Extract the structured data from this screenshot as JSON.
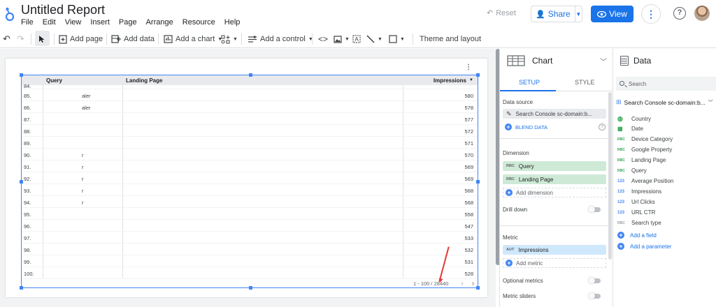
{
  "header": {
    "title": "Untitled Report",
    "menu": [
      "File",
      "Edit",
      "View",
      "Insert",
      "Page",
      "Arrange",
      "Resource",
      "Help"
    ],
    "reset_label": "Reset",
    "share_label": "Share",
    "view_label": "View"
  },
  "toolbar": {
    "add_page": "Add page",
    "add_data": "Add data",
    "add_chart": "Add a chart",
    "add_control": "Add a control",
    "theme_layout": "Theme and layout"
  },
  "table": {
    "headers": {
      "query": "Query",
      "landing_page": "Landing Page",
      "impressions": "Impressions"
    },
    "rows": [
      {
        "idx": "84.",
        "query": "",
        "lp": "",
        "imp": ""
      },
      {
        "idx": "85.",
        "query": "aler",
        "lp": "",
        "imp": "580"
      },
      {
        "idx": "86.",
        "query": "aler",
        "lp": "",
        "imp": "578"
      },
      {
        "idx": "87.",
        "query": "",
        "lp": "",
        "imp": "577"
      },
      {
        "idx": "88.",
        "query": "",
        "lp": "",
        "imp": "572"
      },
      {
        "idx": "89.",
        "query": "",
        "lp": "",
        "imp": "571"
      },
      {
        "idx": "90.",
        "query": "r",
        "lp": "",
        "imp": "570"
      },
      {
        "idx": "91.",
        "query": "r",
        "lp": "",
        "imp": "569"
      },
      {
        "idx": "92.",
        "query": "r",
        "lp": "",
        "imp": "569"
      },
      {
        "idx": "93.",
        "query": "r",
        "lp": "",
        "imp": "568"
      },
      {
        "idx": "94.",
        "query": "r",
        "lp": "",
        "imp": "568"
      },
      {
        "idx": "95.",
        "query": "",
        "lp": "",
        "imp": "558"
      },
      {
        "idx": "96.",
        "query": "",
        "lp": "",
        "imp": "547"
      },
      {
        "idx": "97.",
        "query": "",
        "lp": "",
        "imp": "533"
      },
      {
        "idx": "98.",
        "query": "",
        "lp": "",
        "imp": "532"
      },
      {
        "idx": "99.",
        "query": "",
        "lp": "",
        "imp": "531"
      },
      {
        "idx": "100.",
        "query": "",
        "lp": "",
        "imp": "528"
      }
    ],
    "pagination": "1 - 100 / 28440"
  },
  "chart_panel": {
    "title": "Chart",
    "tabs": [
      "SETUP",
      "STYLE"
    ],
    "data_source_label": "Data source",
    "data_source": "Search Console sc-domain:b...",
    "blend_data": "BLEND DATA",
    "dimension_label": "Dimension",
    "dimensions": [
      {
        "tag": "RBC",
        "name": "Query"
      },
      {
        "tag": "RBC",
        "name": "Landing Page"
      }
    ],
    "add_dimension": "Add dimension",
    "drill_down": "Drill down",
    "metric_label": "Metric",
    "metric": {
      "tag": "AUT",
      "name": "Impressions"
    },
    "add_metric": "Add metric",
    "optional_metrics": "Optional metrics",
    "metric_sliders": "Metric sliders"
  },
  "data_panel": {
    "title": "Data",
    "search_placeholder": "Search",
    "source": "Search Console sc-domain:b...",
    "fields": [
      {
        "tag": "",
        "name": "Country",
        "kind": "geo"
      },
      {
        "tag": "",
        "name": "Date",
        "kind": "date"
      },
      {
        "tag": "RBC",
        "name": "Device Category",
        "kind": "text"
      },
      {
        "tag": "RBC",
        "name": "Google Property",
        "kind": "text"
      },
      {
        "tag": "RBC",
        "name": "Landing Page",
        "kind": "text"
      },
      {
        "tag": "RBC",
        "name": "Query",
        "kind": "text"
      },
      {
        "tag": "123",
        "name": "Average Position",
        "kind": "num"
      },
      {
        "tag": "123",
        "name": "Impressions",
        "kind": "num"
      },
      {
        "tag": "123",
        "name": "Url Clicks",
        "kind": "num"
      },
      {
        "tag": "123",
        "name": "URL CTR",
        "kind": "num"
      },
      {
        "tag": "RBC",
        "name": "Search type",
        "kind": "calc"
      }
    ],
    "add_field": "Add a field",
    "add_parameter": "Add a parameter"
  }
}
